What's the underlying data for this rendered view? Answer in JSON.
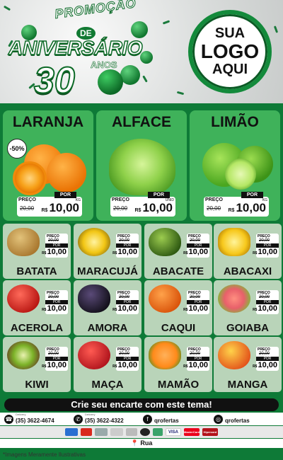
{
  "header": {
    "promo_word": "PROMOÇÃO",
    "de_word": "DE",
    "aniversario_word": "ANIVERSÁRIO",
    "number": "30",
    "anos_word": "ANOS",
    "logo": {
      "line1": "SUA",
      "line2": "LOGO",
      "line3": "AQUI"
    }
  },
  "featured": [
    {
      "name": "LARANJA",
      "discount": "-50%",
      "preco_label": "PREÇO",
      "por_label": "POR",
      "old_price": "20,00",
      "currency": "R$",
      "new_price": "10,00",
      "unit": "KG"
    },
    {
      "name": "ALFACE",
      "preco_label": "PREÇO",
      "por_label": "POR",
      "old_price": "20,00",
      "currency": "R$",
      "new_price": "10,00",
      "unit": "UNID"
    },
    {
      "name": "LIMÃO",
      "preco_label": "PREÇO",
      "por_label": "POR",
      "old_price": "20,00",
      "currency": "R$",
      "new_price": "10,00",
      "unit": "KG"
    }
  ],
  "products": [
    {
      "name": "BATATA",
      "preco": "PREÇO",
      "old": "20,00",
      "por": "POR",
      "new": "10,00",
      "currency": "R$"
    },
    {
      "name": "MARACUJÁ",
      "preco": "PREÇO",
      "old": "20,00",
      "por": "POR",
      "new": "10,00",
      "currency": "R$"
    },
    {
      "name": "ABACATE",
      "preco": "PREÇO",
      "old": "20,00",
      "por": "POR",
      "new": "10,00",
      "currency": "R$"
    },
    {
      "name": "ABACAXI",
      "preco": "PREÇO",
      "old": "20,00",
      "por": "POR",
      "new": "10,00",
      "currency": "R$"
    },
    {
      "name": "ACEROLA",
      "preco": "PREÇO",
      "old": "20,00",
      "por": "POR",
      "new": "10,00",
      "currency": "R$"
    },
    {
      "name": "AMORA",
      "preco": "PREÇO",
      "old": "20,00",
      "por": "POR",
      "new": "10,00",
      "currency": "R$"
    },
    {
      "name": "CAQUI",
      "preco": "PREÇO",
      "old": "20,00",
      "por": "POR",
      "new": "10,00",
      "currency": "R$"
    },
    {
      "name": "GOIABA",
      "preco": "PREÇO",
      "old": "20,00",
      "por": "POR",
      "new": "10,00",
      "currency": "R$"
    },
    {
      "name": "KIWI",
      "preco": "PREÇO",
      "old": "20,00",
      "por": "POR",
      "new": "10,00",
      "currency": "R$"
    },
    {
      "name": "MAÇA",
      "preco": "PREÇO",
      "old": "20,00",
      "por": "POR",
      "new": "10,00",
      "currency": "R$"
    },
    {
      "name": "MAMÃO",
      "preco": "PREÇO",
      "old": "20,00",
      "por": "POR",
      "new": "10,00",
      "currency": "R$"
    },
    {
      "name": "MANGA",
      "preco": "PREÇO",
      "old": "20,00",
      "por": "POR",
      "new": "10,00",
      "currency": "R$"
    }
  ],
  "cta": "Crie seu encarte com este tema!",
  "contacts": [
    {
      "icon": "phone-icon",
      "label": "Delivery",
      "value": "(35) 3622-4674"
    },
    {
      "icon": "whatsapp-icon",
      "label": "Delivery",
      "value": "(35) 3622-4322"
    },
    {
      "icon": "facebook-icon",
      "label": "",
      "value": "qrofertas"
    },
    {
      "icon": "instagram-icon",
      "label": "",
      "value": "qrofertas"
    }
  ],
  "payments": [
    "VISA",
    "MasterCard",
    "Hipercard"
  ],
  "address": "Rua",
  "disclaimer": "*Imagens Meramente Ilustrativas",
  "colors": {
    "dark_green": "#0e7a37",
    "card_green": "#3fb25a",
    "grid_card": "#b9d4b9"
  }
}
